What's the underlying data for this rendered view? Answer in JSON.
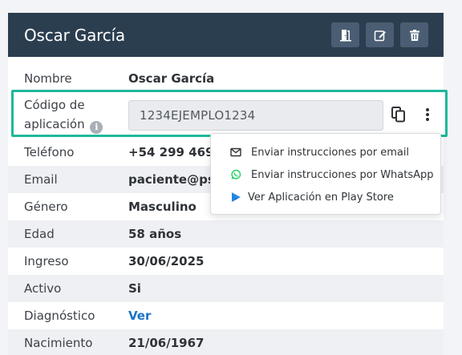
{
  "header": {
    "title": "Oscar García",
    "actions": [
      {
        "icon": "door-exit-icon"
      },
      {
        "icon": "edit-icon"
      },
      {
        "icon": "trash-icon"
      }
    ]
  },
  "rows": {
    "nombre": {
      "label": "Nombre",
      "value": "Oscar García"
    },
    "codigo": {
      "label_line1": "Código de",
      "label_line2": "aplicación",
      "info_glyph": "i",
      "value": "1234EJEMPLO1234"
    },
    "telefono": {
      "label": "Teléfono",
      "value": "+54 299 469-"
    },
    "email": {
      "label": "Email",
      "value": "paciente@psic"
    },
    "genero": {
      "label": "Género",
      "value": "Masculino"
    },
    "edad": {
      "label": "Edad",
      "value": "58 años"
    },
    "ingreso": {
      "label": "Ingreso",
      "value": "30/06/2025"
    },
    "activo": {
      "label": "Activo",
      "value": "Si"
    },
    "diagnostico": {
      "label": "Diagnóstico",
      "value": "Ver"
    },
    "nacimiento": {
      "label": "Nacimiento",
      "value": "21/06/1967"
    }
  },
  "menu": {
    "items": [
      {
        "label": "Enviar instrucciones por email",
        "icon": "envelope-icon"
      },
      {
        "label": "Enviar instrucciones por WhatsApp",
        "icon": "whatsapp-icon"
      },
      {
        "label": "Ver Aplicación en Play Store",
        "icon": "play-store-icon"
      }
    ]
  },
  "colors": {
    "header_bg": "#2b3e50",
    "highlight": "#1fb89a",
    "link": "#1a73c8",
    "whatsapp": "#25d366"
  }
}
